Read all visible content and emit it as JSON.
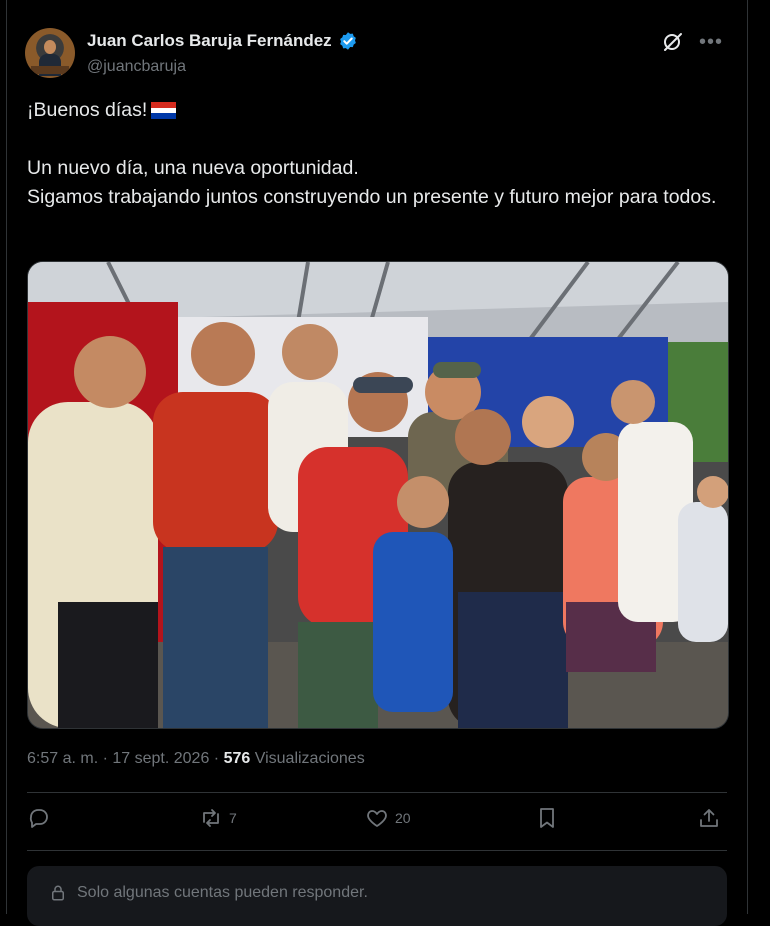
{
  "author": {
    "name": "Juan Carlos Baruja Fernández",
    "handle": "@juancbaruja"
  },
  "tweet": {
    "line1": "¡Buenos días!",
    "line2": "Un nuevo día, una nueva oportunidad.",
    "line3": "Sigamos trabajando juntos construyendo un presente y futuro mejor para todos."
  },
  "meta": {
    "time": "6:57 a. m.",
    "sep1": " · ",
    "date": "17 sept. 2026",
    "sep2": " · ",
    "views": "576",
    "views_label": " Visualizaciones"
  },
  "actions": {
    "replies": "",
    "reposts": "7",
    "likes": "20"
  },
  "reply_restriction": "Solo algunas cuentas pueden responder.",
  "icons": {
    "verified": "verified-badge-icon",
    "grok": "grok-icon",
    "more": "more-icon",
    "reply": "reply-icon",
    "repost": "repost-icon",
    "like": "heart-icon",
    "bookmark": "bookmark-icon",
    "share": "share-icon",
    "lock": "lock-icon"
  },
  "colors": {
    "background": "#000000",
    "text": "#e7e9ea",
    "muted": "#71767b",
    "verified": "#1d9bf0",
    "flag_red": "#d52b1e",
    "flag_white": "#ffffff",
    "flag_blue": "#0038a8"
  }
}
